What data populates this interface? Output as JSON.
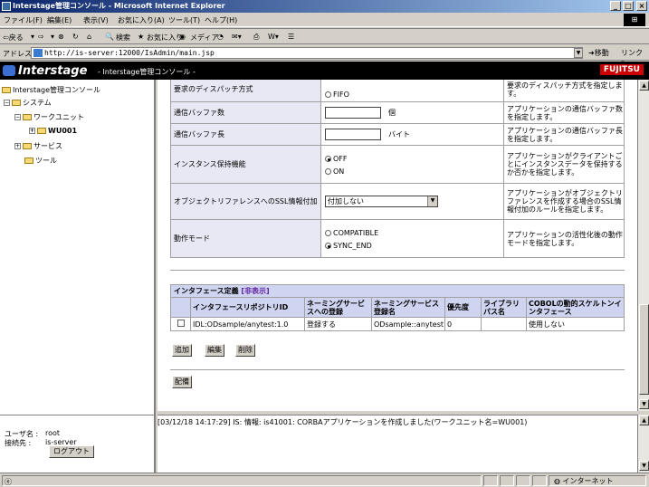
{
  "window": {
    "title": "Interstage管理コンソール - Microsoft Internet Explorer",
    "controls": [
      "_",
      "□",
      "×"
    ]
  },
  "menubar": {
    "items": [
      "ファイル(F)",
      "編集(E)",
      "表示(V)",
      "お気に入り(A)",
      "ツール(T)",
      "ヘルプ(H)"
    ]
  },
  "toolbar": {
    "back": "⇦戻る",
    "forward": "⇨",
    "search": "検索",
    "favorites": "お気に入り",
    "media": "メディア"
  },
  "addressbar": {
    "label": "アドレス(D)",
    "url": "http://is-server:12000/IsAdmin/main.jsp",
    "go": "移動",
    "links": "リンク »"
  },
  "header": {
    "logo": "Interstage",
    "subtitle": "- Interstage管理コンソール -",
    "brand": "FUJITSU"
  },
  "tree": {
    "root": "Interstage管理コンソール",
    "system": "システム",
    "workunit": "ワークユニット",
    "wu001": "WU001",
    "service": "サービス",
    "tool": "ツール"
  },
  "user": {
    "user_label": "ユーザ名 :",
    "user_value": "root",
    "host_label": "接続先 :",
    "host_value": "is-server",
    "logout": "ログアウト"
  },
  "props": {
    "rows": [
      {
        "label": "要求のディスパッチ方式",
        "option": "FIFO",
        "desc": "要求のディスパッチ方式を指定します。"
      },
      {
        "label": "通信バッファ数",
        "unit": "個",
        "desc": "アプリケーションの通信バッファ数を指定します。"
      },
      {
        "label": "通信バッファ長",
        "unit": "バイト",
        "desc": "アプリケーションの通信バッファ長を指定します。"
      },
      {
        "label": "インスタンス保持機能",
        "opt1": "OFF",
        "opt2": "ON",
        "desc": "アプリケーションがクライアントごとにインスタンスデータを保持するか否かを指定します。"
      },
      {
        "label": "オブジェクトリファレンスへのSSL情報付加",
        "select": "付加しない",
        "desc": "アプリケーションがオブジェクトリファレンスを作成する場合のSSL情報付加のルールを指定します。"
      },
      {
        "label": "動作モード",
        "opt1": "COMPATIBLE",
        "opt2": "SYNC_END",
        "desc": "アプリケーションの活性化後の動作モードを指定します。"
      }
    ]
  },
  "interface": {
    "title": "インタフェース定義",
    "hide_link": "[非表示]",
    "headers": [
      "インタフェースリポジトリID",
      "ネーミングサービスへの登録",
      "ネーミングサービス登録名",
      "優先度",
      "ライブラリパス名",
      "COBOLの動的スケルトンインタフェース"
    ],
    "row": [
      "IDL:ODsample/anytest:1.0",
      "登録する",
      "ODsample::anytest",
      "0",
      "",
      "使用しない"
    ],
    "add": "追加",
    "edit": "編集",
    "delete": "削除",
    "deploy": "配備"
  },
  "message": "[03/12/18 14:17:29] IS: 情報: is41001: CORBAアプリケーションを作成しました(ワークユニット名=WU001)",
  "status": {
    "zone": "インターネット"
  }
}
